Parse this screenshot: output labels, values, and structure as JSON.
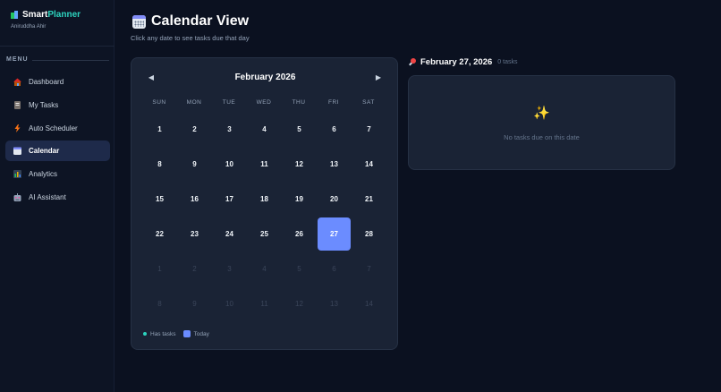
{
  "app": {
    "brand_part1": "Smart",
    "brand_part2": "Planner",
    "user": "Aniruddha Ahir"
  },
  "sidebar": {
    "menu_label": "MENU",
    "items": [
      {
        "label": "Dashboard",
        "icon": "house-icon"
      },
      {
        "label": "My Tasks",
        "icon": "notebook-icon"
      },
      {
        "label": "Auto Scheduler",
        "icon": "lightning-icon"
      },
      {
        "label": "Calendar",
        "icon": "calendar-icon",
        "active": true
      },
      {
        "label": "Analytics",
        "icon": "bar-chart-icon"
      },
      {
        "label": "AI Assistant",
        "icon": "robot-icon"
      }
    ]
  },
  "header": {
    "title": "Calendar View",
    "subtitle": "Click any date to see tasks due that day"
  },
  "calendar": {
    "prev_label": "◀",
    "next_label": "▶",
    "month_title": "February 2026",
    "weekdays": [
      "SUN",
      "MON",
      "TUE",
      "WED",
      "THU",
      "FRI",
      "SAT"
    ],
    "weeks": [
      [
        "1",
        "2",
        "3",
        "4",
        "5",
        "6",
        "7"
      ],
      [
        "8",
        "9",
        "10",
        "11",
        "12",
        "13",
        "14"
      ],
      [
        "15",
        "16",
        "17",
        "18",
        "19",
        "20",
        "21"
      ],
      [
        "22",
        "23",
        "24",
        "25",
        "26",
        "27",
        "28"
      ],
      [
        "1",
        "2",
        "3",
        "4",
        "5",
        "6",
        "7"
      ],
      [
        "8",
        "9",
        "10",
        "11",
        "12",
        "13",
        "14"
      ]
    ],
    "muted_weeks": [
      4,
      5
    ],
    "today": "27",
    "legend": {
      "has_tasks": "Has tasks",
      "today": "Today"
    }
  },
  "selected": {
    "date": "February 27, 2026",
    "count": "0 tasks",
    "empty_icon": "sparkles-icon",
    "empty_text": "No tasks due on this date"
  },
  "colors": {
    "accent": "#6b8cff",
    "teal": "#2dd4bf",
    "background": "#0b1120",
    "card": "#1a2335"
  }
}
